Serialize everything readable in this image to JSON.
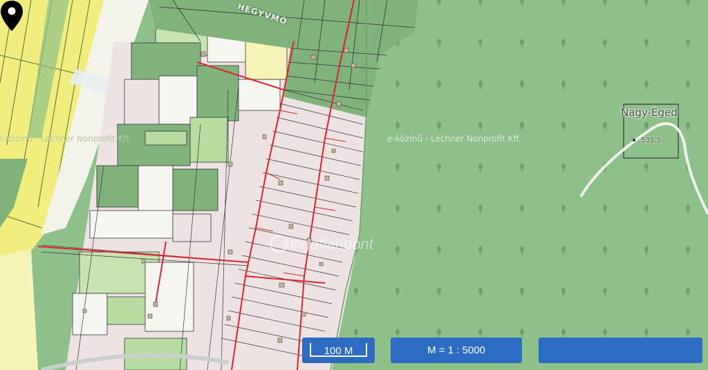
{
  "map": {
    "street_label": "HEGYVMÓ",
    "copyright_left": "e-közmű - Lechner Nonprofit Kft",
    "copyright_right": "e-közmű - Lechner Nonprofit Kft",
    "peak_name": "Nagy-Eged",
    "peak_elevation": "535.5",
    "watermark": "ingatlanpont",
    "colors": {
      "forest": "#8ec08a",
      "agri_yellow": "#f2ee7e",
      "parcel_pink": "#ede3e3",
      "parcel_green": "#b6dca0",
      "utility_red": "#e0202a",
      "controls": "#2e6bc2"
    }
  },
  "controls": {
    "scale_label": "100 M",
    "ratio_label": "M = 1 : 5000",
    "blank_label": ""
  },
  "marker": {
    "icon": "location-pin-icon"
  }
}
